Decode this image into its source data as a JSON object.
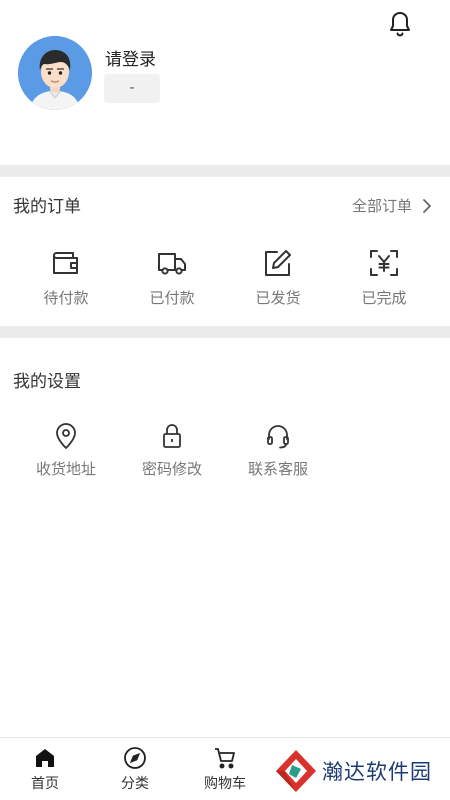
{
  "profile": {
    "login_prompt": "请登录",
    "tag": "-"
  },
  "orders": {
    "title": "我的订单",
    "all_label": "全部订单",
    "items": [
      {
        "label": "待付款",
        "icon": "wallet-icon"
      },
      {
        "label": "已付款",
        "icon": "truck-icon"
      },
      {
        "label": "已发货",
        "icon": "edit-icon"
      },
      {
        "label": "已完成",
        "icon": "yen-scan-icon"
      }
    ]
  },
  "settings": {
    "title": "我的设置",
    "items": [
      {
        "label": "收货地址",
        "icon": "location-pin-icon"
      },
      {
        "label": "密码修改",
        "icon": "lock-icon"
      },
      {
        "label": "联系客服",
        "icon": "headset-icon"
      }
    ]
  },
  "tabbar": {
    "items": [
      {
        "label": "首页",
        "icon": "home-icon"
      },
      {
        "label": "分类",
        "icon": "compass-icon"
      },
      {
        "label": "购物车",
        "icon": "cart-icon"
      }
    ]
  },
  "watermark": {
    "text": "瀚达软件园"
  },
  "colors": {
    "separator": "#ececec",
    "avatar_bg": "#5b9be6",
    "watermark_text": "#1d3b73",
    "watermark_red": "#d9322e",
    "watermark_teal": "#2a9d8f"
  }
}
